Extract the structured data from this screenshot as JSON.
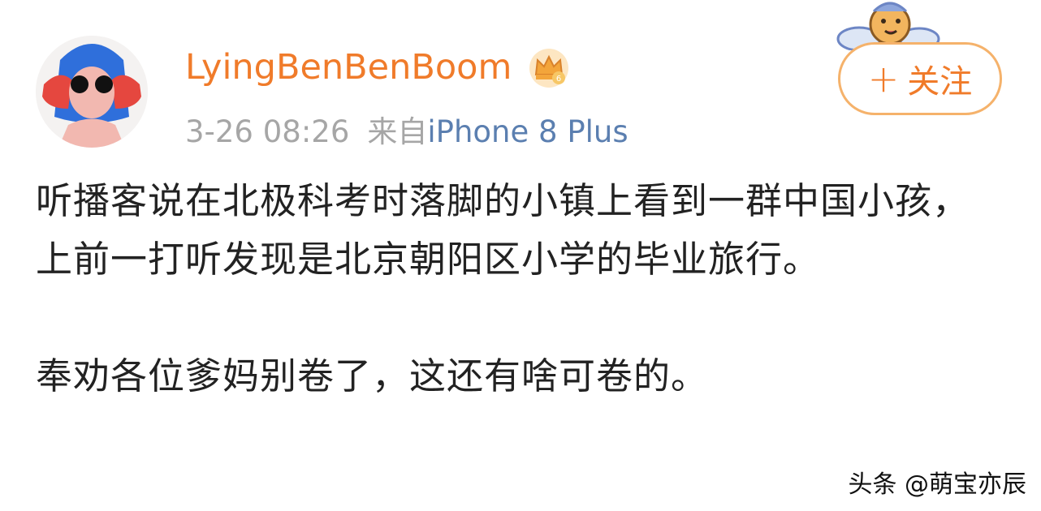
{
  "post": {
    "author": {
      "name": "LyingBenBenBoom",
      "badge_icon": "crown-vip-icon",
      "avatar_icon": "cartoon-avatar"
    },
    "time": "3-26 08:26",
    "source_prefix": "来自",
    "source_device": "iPhone 8 Plus",
    "follow_label": "关注",
    "paragraphs": [
      "听播客说在北极科考时落脚的小镇上看到一群中国小孩，上前一打听发现是北京朝阳区小学的毕业旅行。",
      "奉劝各位爹妈别卷了，这还有啥可卷的。"
    ]
  },
  "watermark": "头条 @萌宝亦辰",
  "colors": {
    "username": "#f07b2a",
    "source_link": "#5b7fb0",
    "meta_gray": "#a6a6a6",
    "follow_border": "#f5b26b",
    "text": "#222222"
  }
}
